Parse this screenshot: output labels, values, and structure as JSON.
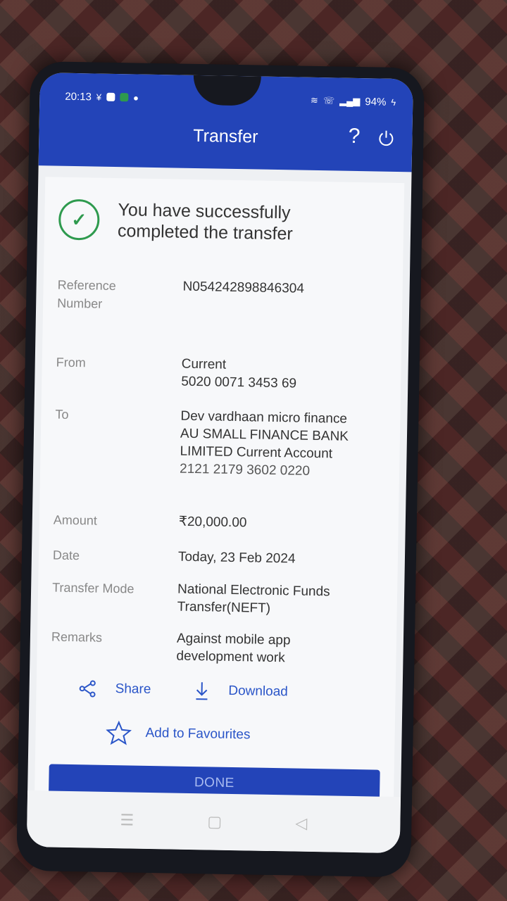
{
  "status_bar": {
    "time": "20:13",
    "battery": "94%"
  },
  "header": {
    "title": "Transfer"
  },
  "success": {
    "message": "You have successfully completed the transfer"
  },
  "details": {
    "reference_label": "Reference Number",
    "reference_value": "N054242898846304",
    "from_label": "From",
    "from_account_type": "Current",
    "from_account_number": "5020 0071 3453 69",
    "to_label": "To",
    "to_name": "Dev vardhaan micro finance",
    "to_bank": "AU SMALL FINANCE BANK LIMITED Current Account",
    "to_account_number": "2121 2179 3602 0220",
    "amount_label": "Amount",
    "amount_value": "₹20,000.00",
    "date_label": "Date",
    "date_value": "Today, 23 Feb 2024",
    "mode_label": "Transfer Mode",
    "mode_value": "National Electronic Funds Transfer(NEFT)",
    "remarks_label": "Remarks",
    "remarks_value": "Against mobile app development work"
  },
  "actions": {
    "share_label": "Share",
    "download_label": "Download",
    "favourites_label": "Add to Favourites",
    "done_label": "DONE"
  },
  "colors": {
    "primary": "#2344b8",
    "success": "#2e9a4e",
    "link": "#2a55c8"
  }
}
